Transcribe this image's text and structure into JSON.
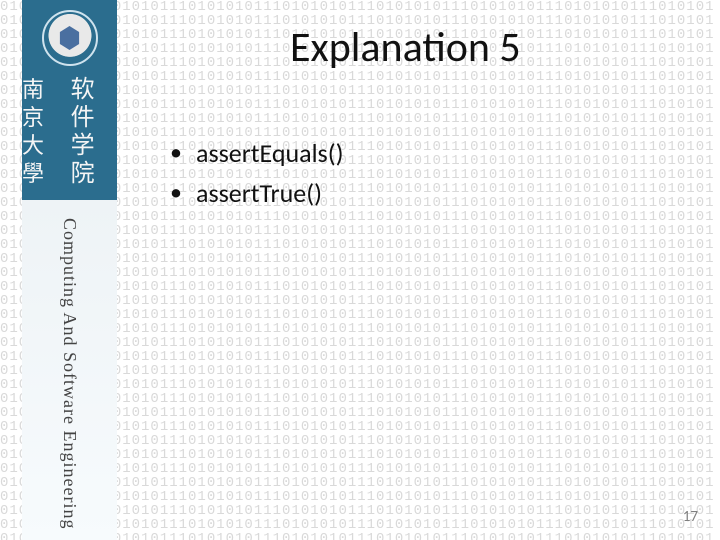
{
  "slide": {
    "title": "Explanation 5",
    "bullets": [
      "assertEquals()",
      "assertTrue()"
    ],
    "page_number": "17"
  },
  "sidebar": {
    "chinese_university": "南京大學",
    "chinese_school": "软件学院",
    "english_line": "Computing And Software Engineering"
  }
}
